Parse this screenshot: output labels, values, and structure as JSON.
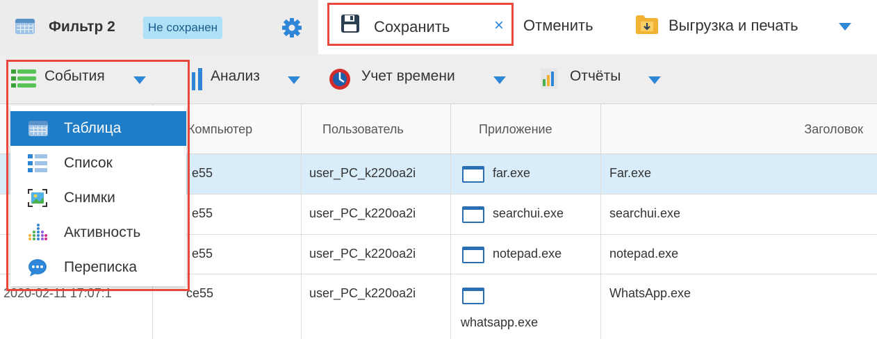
{
  "header": {
    "filter_title": "Фильтр 2",
    "unsaved_badge": "Не сохранен",
    "save_label": "Сохранить",
    "close_glyph": "×",
    "cancel_label": "Отменить",
    "export_label": "Выгрузка и печать"
  },
  "toolbar": {
    "events_label": "События",
    "analysis_label": "Анализ",
    "time_label": "Учет времени",
    "reports_label": "Отчёты"
  },
  "menu": {
    "items": [
      {
        "label": "Таблица",
        "icon": "table-icon"
      },
      {
        "label": "Список",
        "icon": "list-icon"
      },
      {
        "label": "Снимки",
        "icon": "screenshot-icon"
      },
      {
        "label": "Активность",
        "icon": "activity-icon"
      },
      {
        "label": "Переписка",
        "icon": "chat-icon"
      }
    ]
  },
  "table": {
    "columns": [
      "Компьютер",
      "Пользователь",
      "Приложение",
      "Заголовок"
    ],
    "rows": [
      {
        "computer": "e55",
        "user": "user_PC_k220oa2i",
        "app": "far.exe",
        "title": "Far.exe"
      },
      {
        "computer": "e55",
        "user": "user_PC_k220oa2i",
        "app": "searchui.exe",
        "title": "searchui.exe"
      },
      {
        "computer": "e55",
        "user": "user_PC_k220oa2i",
        "app": "notepad.exe",
        "title": "notepad.exe"
      },
      {
        "computer": "ce55",
        "user": "user_PC_k220oa2i",
        "app": "whatsapp.exe",
        "title": "WhatsApp.exe"
      }
    ],
    "partial_date": "2020-02-11 17:07:1"
  },
  "colors": {
    "accent": "#1f7cc6",
    "highlight_border": "#e8473b",
    "selected_row": "#d9ecfa"
  }
}
